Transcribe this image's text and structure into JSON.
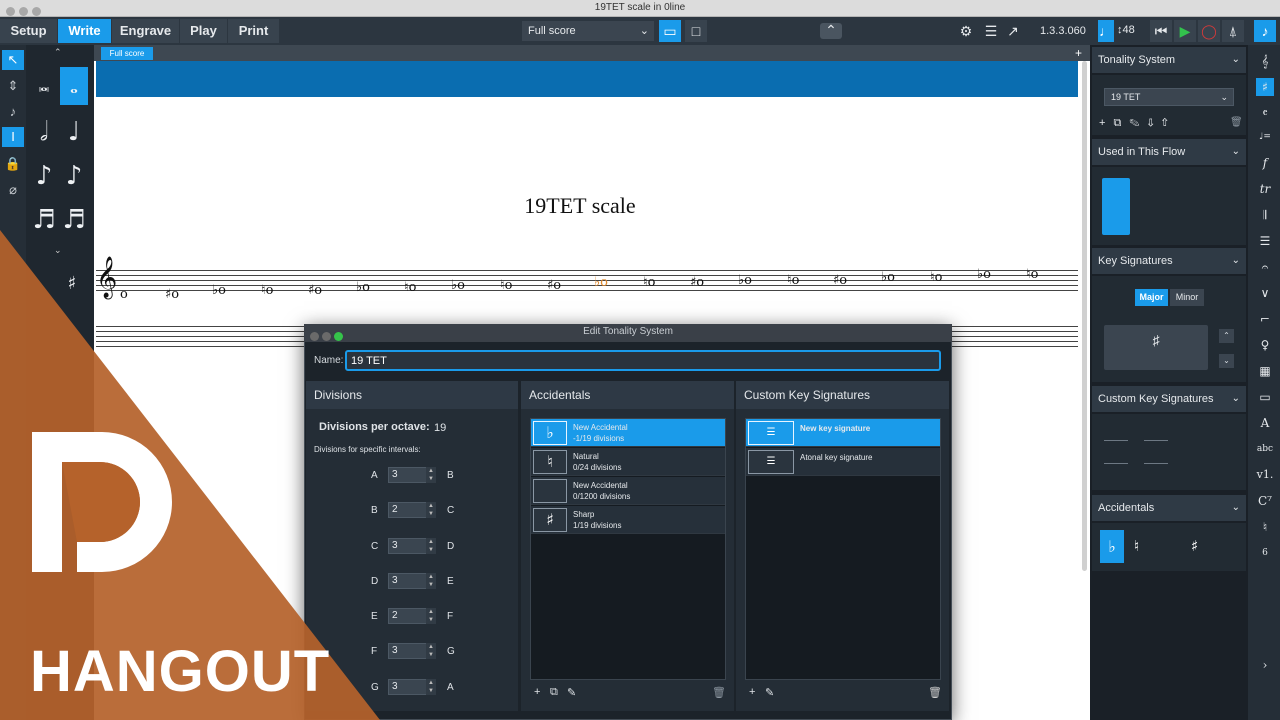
{
  "window": {
    "title": "19TET scale in 0line"
  },
  "modes": [
    "Setup",
    "Write",
    "Engrave",
    "Play",
    "Print"
  ],
  "toolbar": {
    "layout_select": "Full score",
    "version": "1.3.3.060",
    "tempo": "48"
  },
  "score": {
    "tab": "Full score",
    "title": "19TET scale",
    "notes": [
      "o",
      "♯o",
      "♭o",
      "♮o",
      "♯o",
      "♭o",
      "♮o",
      "♭o",
      "♮o",
      "♯o",
      "♭o",
      "♮o",
      "♯o",
      "♭o",
      "♮o",
      "♯o",
      "♭o",
      "♮o",
      "♭o",
      "♮o"
    ]
  },
  "right_panel": {
    "tonality": {
      "title": "Tonality System",
      "selected": "19 TET"
    },
    "used_flow": {
      "title": "Used in This Flow"
    },
    "key_sigs": {
      "title": "Key Signatures",
      "major": "Major",
      "minor": "Minor"
    },
    "custom_key_sigs": {
      "title": "Custom Key Signatures"
    },
    "accidentals": {
      "title": "Accidentals"
    }
  },
  "dialog": {
    "title": "Edit Tonality System",
    "name_label": "Name:",
    "name_value": "19 TET",
    "divisions": {
      "header": "Divisions",
      "per_octave_label": "Divisions per octave:",
      "per_octave_value": "19",
      "intervals_label": "Divisions for specific intervals:",
      "rows": [
        {
          "from": "A",
          "value": "3",
          "to": "B"
        },
        {
          "from": "B",
          "value": "2",
          "to": "C"
        },
        {
          "from": "C",
          "value": "3",
          "to": "D"
        },
        {
          "from": "D",
          "value": "3",
          "to": "E"
        },
        {
          "from": "E",
          "value": "2",
          "to": "F"
        },
        {
          "from": "F",
          "value": "3",
          "to": "G"
        },
        {
          "from": "G",
          "value": "3",
          "to": "A"
        }
      ]
    },
    "accidentals": {
      "header": "Accidentals",
      "items": [
        {
          "symbol": "♭",
          "name": "New Accidental",
          "detail": "-1/19 divisions"
        },
        {
          "symbol": "♮",
          "name": "Natural",
          "detail": "0/24 divisions"
        },
        {
          "symbol": "",
          "name": "New Accidental",
          "detail": "0/1200 divisions"
        },
        {
          "symbol": "♯",
          "name": "Sharp",
          "detail": "1/19 divisions"
        }
      ]
    },
    "custom_key_sigs": {
      "header": "Custom Key Signatures",
      "items": [
        {
          "name": "New key signature"
        },
        {
          "name": "Atonal key signature"
        }
      ]
    }
  },
  "branding": {
    "text": "HANGOUT",
    "accent": "#b5622b"
  },
  "colors": {
    "accent": "#1a9bea",
    "panel": "#2f3a45",
    "score_band": "#0a6db0"
  }
}
